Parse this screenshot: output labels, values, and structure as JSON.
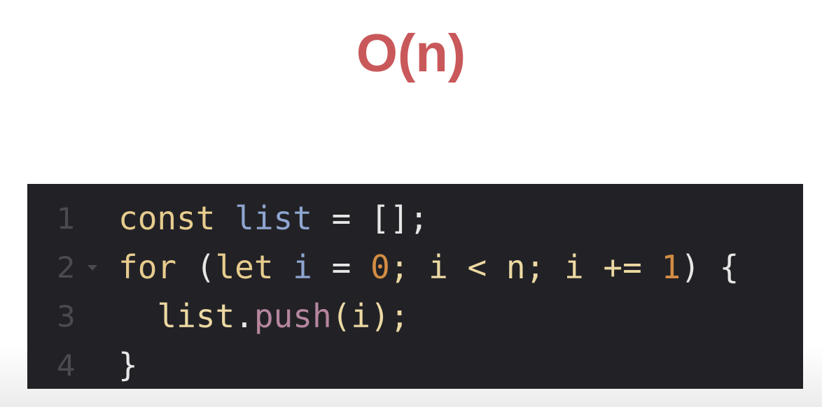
{
  "title": "O(n)",
  "editor": {
    "lines": [
      {
        "number": "1",
        "tokens": {
          "t1": "const ",
          "t2": "list",
          "t3": " = [];"
        }
      },
      {
        "number": "2",
        "tokens": {
          "t1": "for",
          "t2": " (",
          "t3": "let ",
          "t4": "i",
          "t5": " = ",
          "t6": "0",
          "t7": "; i < n; i += ",
          "t8": "1",
          "t9": ") {"
        }
      },
      {
        "number": "3",
        "tokens": {
          "t1": "  list",
          "t2": ".",
          "t3": "push",
          "t4": "(i);"
        }
      },
      {
        "number": "4",
        "tokens": {
          "t1": "}"
        }
      }
    ]
  },
  "colors": {
    "title": "#c9585a",
    "editor_bg": "#222226",
    "keyword": "#e7cc8e",
    "variable": "#8fa6d1",
    "number": "#d48d43",
    "method": "#b6869f"
  },
  "icons": {
    "fold_marker": "chevron-down-icon"
  }
}
